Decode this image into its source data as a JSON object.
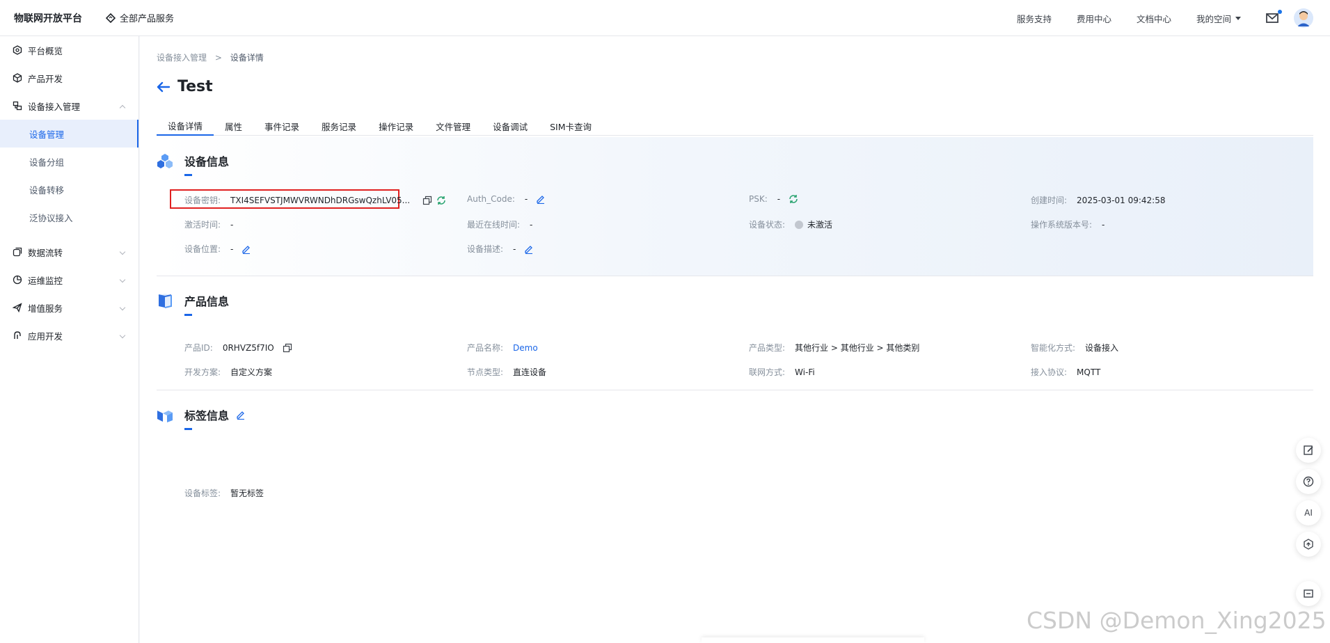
{
  "topbar": {
    "brand": "物联网开放平台",
    "all_products": "全部产品服务",
    "nav": [
      "服务支持",
      "费用中心",
      "文档中心"
    ],
    "my_space": "我的空间"
  },
  "sidebar": {
    "items": [
      {
        "label": "平台概览",
        "icon": "overview-icon"
      },
      {
        "label": "产品开发",
        "icon": "cube-icon"
      },
      {
        "label": "设备接入管理",
        "icon": "device-access-icon",
        "expanded": true
      },
      {
        "label": "数据流转",
        "icon": "data-flow-icon"
      },
      {
        "label": "运维监控",
        "icon": "monitor-icon"
      },
      {
        "label": "增值服务",
        "icon": "send-icon"
      },
      {
        "label": "应用开发",
        "icon": "app-dev-icon"
      }
    ],
    "sub_items": [
      "设备管理",
      "设备分组",
      "设备转移",
      "泛协议接入"
    ],
    "active_sub": "设备管理"
  },
  "breadcrumb": {
    "parent": "设备接入管理",
    "separator": ">",
    "current": "设备详情"
  },
  "page": {
    "title": "Test"
  },
  "tabs": [
    "设备详情",
    "属性",
    "事件记录",
    "服务记录",
    "操作记录",
    "文件管理",
    "设备调试",
    "SIM卡查询"
  ],
  "device_info": {
    "title": "设备信息",
    "secret_label": "设备密钥:",
    "secret_value": "TXI4SEFVSTJMWVRWNDhDRGswQzhLV05...",
    "auth_code_label": "Auth_Code:",
    "auth_code_value": "-",
    "psk_label": "PSK:",
    "psk_value": "-",
    "created_label": "创建时间:",
    "created_value": "2025-03-01 09:42:58",
    "activated_label": "激活时间:",
    "activated_value": "-",
    "last_online_label": "最近在线时间:",
    "last_online_value": "-",
    "status_label": "设备状态:",
    "status_value": "未激活",
    "os_version_label": "操作系统版本号:",
    "os_version_value": "-",
    "location_label": "设备位置:",
    "location_value": "-",
    "description_label": "设备描述:",
    "description_value": "-"
  },
  "product_info": {
    "title": "产品信息",
    "id_label": "产品ID:",
    "id_value": "0RHVZ5f7IO",
    "name_label": "产品名称:",
    "name_value": "Demo",
    "type_label": "产品类型:",
    "type_value": "其他行业 > 其他行业 > 其他类别",
    "smart_label": "智能化方式:",
    "smart_value": "设备接入",
    "dev_plan_label": "开发方案:",
    "dev_plan_value": "自定义方案",
    "node_type_label": "节点类型:",
    "node_type_value": "直连设备",
    "network_label": "联网方式:",
    "network_value": "Wi-Fi",
    "protocol_label": "接入协议:",
    "protocol_value": "MQTT"
  },
  "tag_info": {
    "title": "标签信息",
    "tag_label": "设备标签:",
    "tag_value": "暂无标签"
  },
  "float_buttons": {
    "ai": "AI"
  },
  "watermark": "CSDN @Demon_Xing2025",
  "colors": {
    "accent": "#1a66e8",
    "highlight_box": "#e02020",
    "refresh_green": "#2ba471"
  }
}
